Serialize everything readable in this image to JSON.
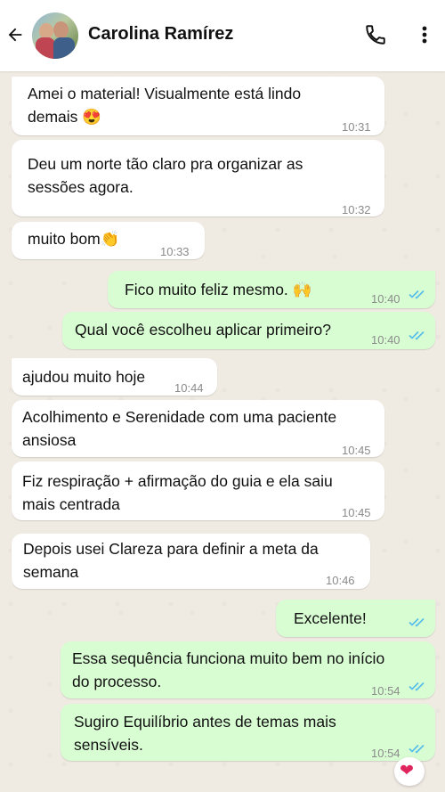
{
  "header": {
    "contact_name": "Carolina Ramírez"
  },
  "messages": [
    {
      "lines": [
        "Amei o material! Visualmente está lindo",
        "demais 😍"
      ],
      "time": "10:31"
    },
    {
      "lines": [
        "Deu um norte tão claro pra organizar as",
        "sessões agora."
      ],
      "time": "10:32"
    },
    {
      "lines": [
        "muito bom👏"
      ],
      "time": "10:33"
    },
    {
      "lines": [
        "Fico muito feliz mesmo. 🙌"
      ],
      "time": "10:40"
    },
    {
      "lines": [
        "Qual você escolheu aplicar primeiro?"
      ],
      "time": "10:40"
    },
    {
      "lines": [
        "ajudou muito hoje"
      ],
      "time": "10:44"
    },
    {
      "lines": [
        "Acolhimento e Serenidade com uma paciente",
        "ansiosa"
      ],
      "time": "10:45"
    },
    {
      "lines": [
        "Fiz respiração + afirmação do guia e ela saiu",
        "mais centrada"
      ],
      "time": "10:45"
    },
    {
      "lines": [
        " Depois usei Clareza para definir a meta da",
        "semana"
      ],
      "time": "10:46"
    },
    {
      "lines": [
        "Excelente!"
      ],
      "time": ""
    },
    {
      "lines": [
        "Essa sequência funciona muito bem no início",
        "do processo."
      ],
      "time": "10:54"
    },
    {
      "lines": [
        "Sugiro Equilíbrio antes de temas mais",
        "sensíveis."
      ],
      "time": "10:54"
    }
  ],
  "reaction": {
    "emoji": "❤"
  },
  "colors": {
    "incoming": "#ffffff",
    "outgoing": "#d9fdd3",
    "read_tick": "#53bdeb",
    "background": "#efeae2"
  },
  "icons": [
    "back-arrow-icon",
    "phone-icon",
    "more-vertical-icon",
    "double-check-icon",
    "heart-icon"
  ]
}
